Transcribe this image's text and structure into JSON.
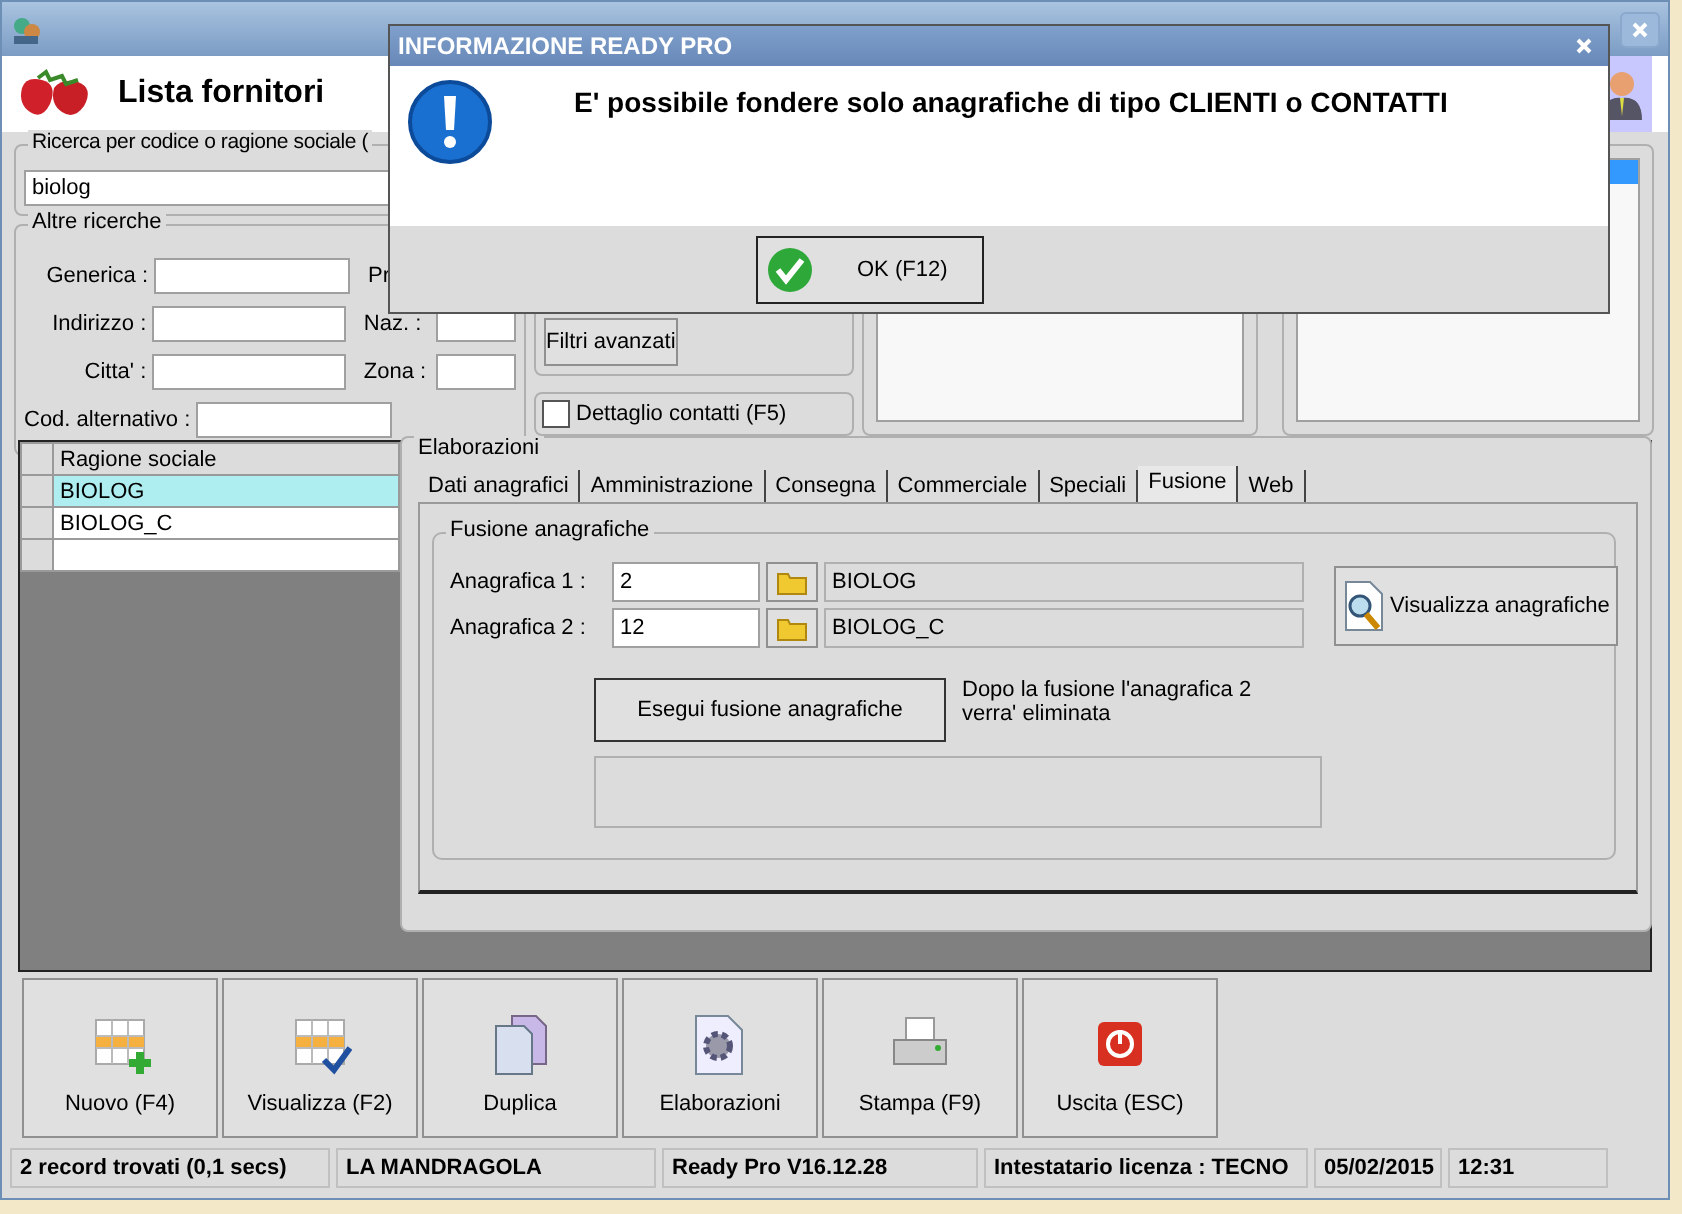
{
  "header": {
    "title": "Lista fornitori"
  },
  "search": {
    "label": "Ricerca per codice o ragione sociale (",
    "value": "biolog"
  },
  "other_searches": {
    "title": "Altre ricerche",
    "left_fields": [
      {
        "label": "Generica :"
      },
      {
        "label": "Indirizzo :"
      },
      {
        "label": "Citta' :"
      }
    ],
    "right_fields": [
      {
        "label": "Pr"
      },
      {
        "label": "Naz. :"
      },
      {
        "label": "Zona :"
      }
    ],
    "alt_code": {
      "label": "Cod. alternativo :"
    }
  },
  "filters_button": "Filtri avanzati",
  "contacts_detail": {
    "label": "Dettaglio contatti (F5)",
    "checked": false
  },
  "side_list": {
    "first_row_selected": true
  },
  "grid": {
    "columns": [
      "Ragione sociale"
    ],
    "rows": [
      {
        "cells": [
          "BIOLOG"
        ],
        "selected": true
      },
      {
        "cells": [
          "BIOLOG_C"
        ],
        "selected": false
      }
    ]
  },
  "elaborazioni": {
    "title": "Elaborazioni",
    "tabs": [
      {
        "label": "Dati anagrafici",
        "selected": false
      },
      {
        "label": "Amministrazione",
        "selected": false
      },
      {
        "label": "Consegna",
        "selected": false
      },
      {
        "label": "Commerciale",
        "selected": false
      },
      {
        "label": "Speciali",
        "selected": false
      },
      {
        "label": "Fusione",
        "selected": true
      },
      {
        "label": "Web",
        "selected": false
      }
    ],
    "merge": {
      "title": "Fusione anagrafiche",
      "records": [
        {
          "label": "Anagrafica 1 :",
          "value": "2",
          "name": "BIOLOG"
        },
        {
          "label": "Anagrafica 2 :",
          "value": "12",
          "name": "BIOLOG_C"
        }
      ],
      "view_button": "Visualizza anagrafiche",
      "run_button": "Esegui fusione anagrafiche",
      "note": "Dopo la fusione l'anagrafica 2 verra' eliminata"
    }
  },
  "toolbar": [
    {
      "label": "Nuovo (F4)",
      "kind": "new"
    },
    {
      "label": "Visualizza (F2)",
      "kind": "view"
    },
    {
      "label": "Duplica",
      "kind": "copy"
    },
    {
      "label": "Elaborazioni",
      "kind": "process"
    },
    {
      "label": "Stampa (F9)",
      "kind": "print"
    },
    {
      "label": "Uscita (ESC)",
      "kind": "exit"
    }
  ],
  "status_bar": [
    "2 record trovati (0,1 secs)",
    "LA MANDRAGOLA",
    "Ready Pro V16.12.28",
    "Intestatario licenza : TECNO",
    "05/02/2015",
    "12:31"
  ],
  "dialog": {
    "title": "INFORMAZIONE READY PRO",
    "message": "E' possibile fondere solo anagrafiche di tipo CLIENTI o CONTATTI",
    "button": "OK (F12)"
  }
}
